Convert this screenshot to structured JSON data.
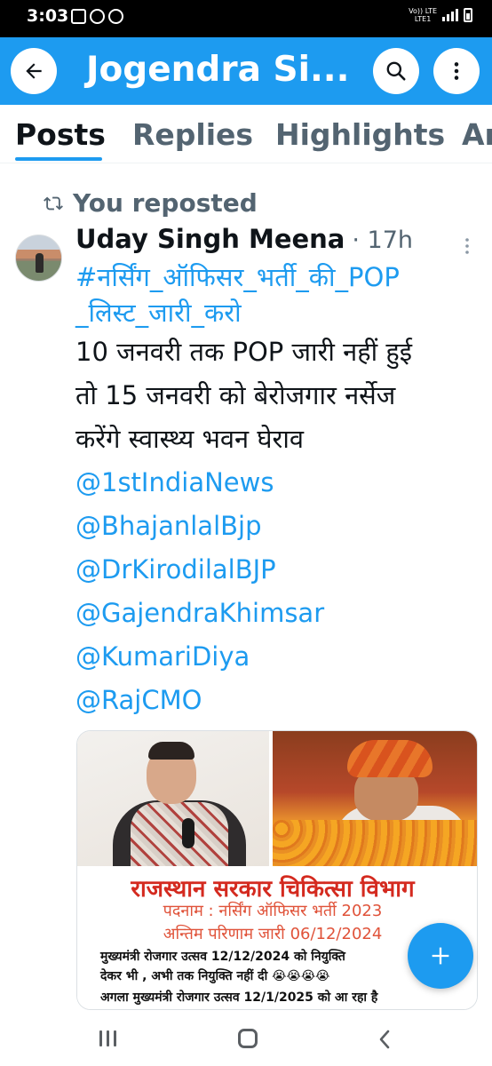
{
  "status_bar": {
    "time": "3:03",
    "network_label_top": "Vo)) LTE",
    "network_label_bottom": "LTE1"
  },
  "app_bar": {
    "title": "Jogendra Si...",
    "accent_color": "#1d9bf0"
  },
  "tabs": [
    {
      "label": "Posts",
      "active": true
    },
    {
      "label": "Replies",
      "active": false
    },
    {
      "label": "Highlights",
      "active": false
    },
    {
      "label": "Ar",
      "active": false
    }
  ],
  "post": {
    "repost_label": "You reposted",
    "author_name": "Uday Singh Meena",
    "time": "· 17h",
    "hashtag_lines": [
      "#नर्सिंग_ऑफिसर_भर्ती_की_POP",
      "_लिस्ट_जारी_करो"
    ],
    "body_lines": [
      "10 जनवरी तक POP जारी नहीं हुई",
      "तो 15 जनवरी को बेरोजगार नर्सेज",
      "करेंगे स्वास्थ्य भवन घेराव"
    ],
    "mentions": [
      "@1stIndiaNews",
      "@BhajanlalBjp",
      "@DrKirodilalBJP",
      "@GajendraKhimsar",
      "@KumariDiya",
      "@RajCMO"
    ]
  },
  "media": {
    "poster_title": "राजस्थान सरकार चिकित्सा विभाग",
    "poster_line2": "पदनाम : नर्सिंग ऑफिसर भर्ती 2023",
    "poster_line3": "अन्तिम परिणाम जारी 06/12/2024",
    "poster_line4": "मुख्यमंत्री रोजगार उत्सव 12/12/2024 को नियुक्ति",
    "poster_line5": "देकर भी , अभी तक नियुक्ति नहीं दी 😭😭😭😭",
    "poster_line6": "अगला मुख्यमंत्री रोजगार उत्सव 12/1/2025 को आ रहा है"
  },
  "icons": {
    "back": "arrow-left-icon",
    "search": "search-icon",
    "more": "more-vertical-icon",
    "repost": "repost-icon",
    "compose": "plus-icon"
  }
}
